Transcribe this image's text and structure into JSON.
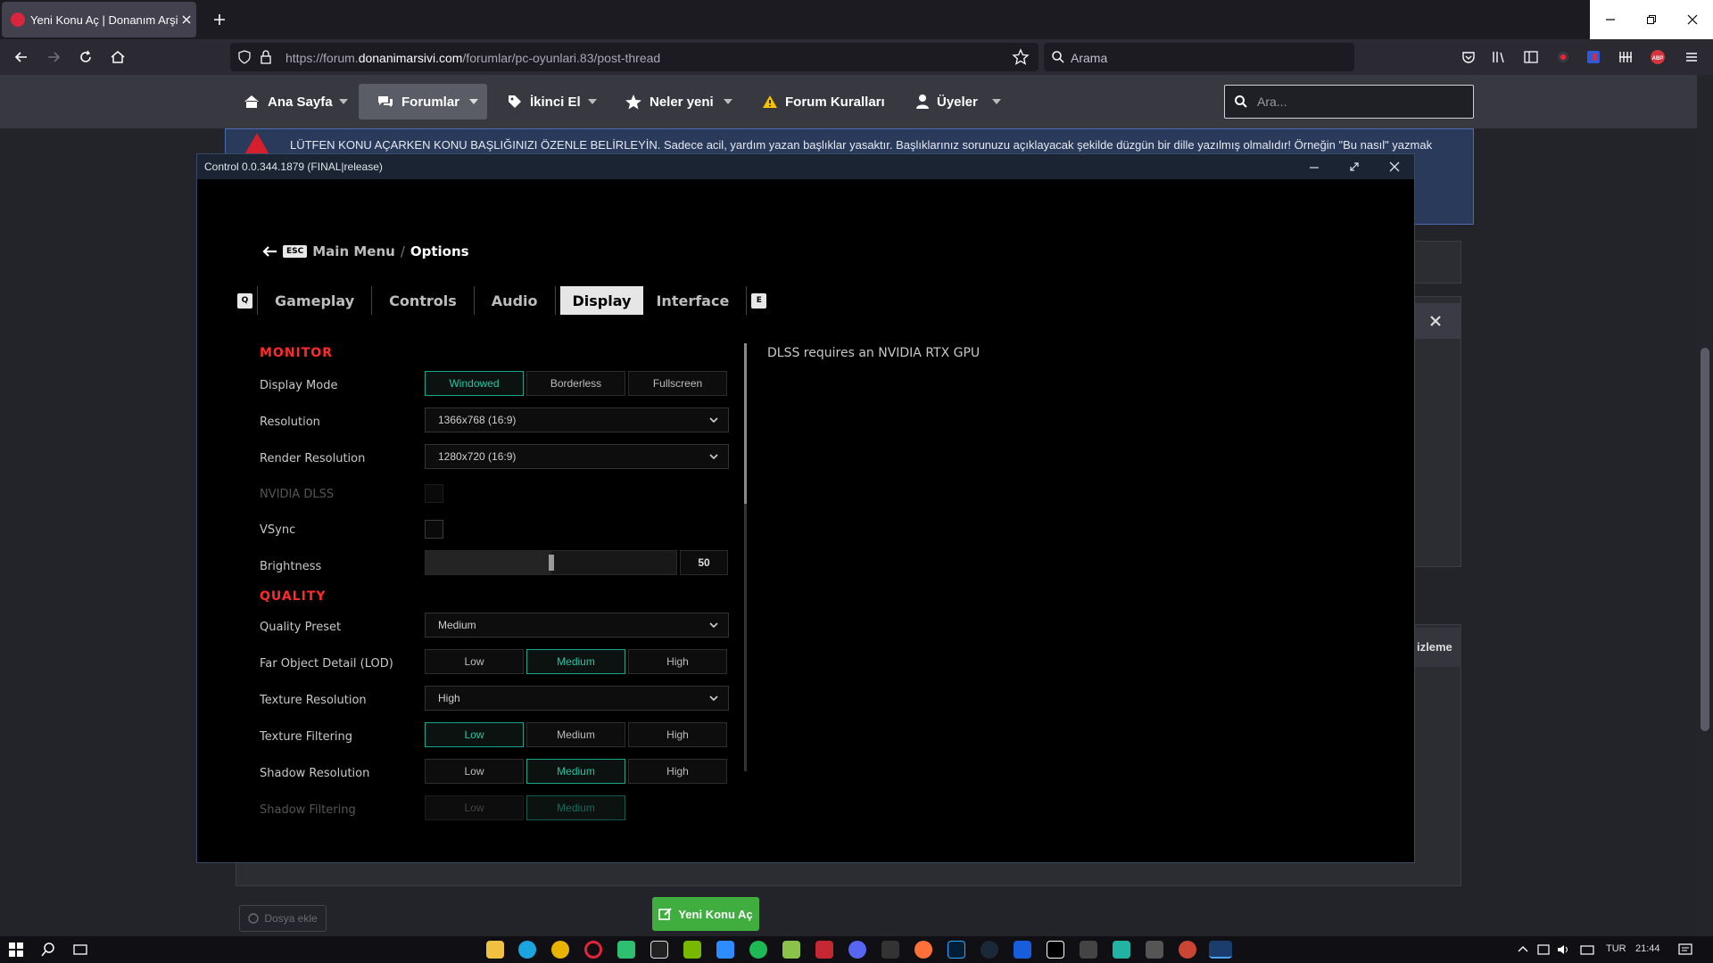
{
  "browser": {
    "tab_title": "Yeni Konu Aç | Donanım Arşivi F",
    "url_prefix": "https://forum.",
    "url_domain": "donanimarsivi.com",
    "url_path": "/forumlar/pc-oyunlari.83/post-thread",
    "search_placeholder": "Arama"
  },
  "site": {
    "nav": {
      "home": "Ana Sayfa",
      "forums": "Forumlar",
      "second_hand": "İkinci El",
      "whats_new": "Neler yeni",
      "rules": "Forum Kuralları",
      "members": "Üyeler"
    },
    "search_placeholder": "Ara...",
    "notice": "LÜTFEN KONU AÇARKEN KONU BAŞLIĞINIZI ÖZENLE BELİRLEYİN. Sadece acil, yardım yazan başlıklar yasaktır. Başlıklarınız sorunuzu açıklayacak şekilde düzgün bir dille yazılmış olmalıdır! Örneğin \"Bu nasıl\" yazmak",
    "preview_label": "izleme",
    "attach_label": "Dosya ekle",
    "new_thread_label": "Yeni Konu Aç"
  },
  "game": {
    "window_title": "Control 0.0.344.1879 (FINAL|release)",
    "breadcrumb": {
      "esc": "ESC",
      "main": "Main Menu",
      "sep": "/",
      "current": "Options"
    },
    "tabs": {
      "left_key": "Q",
      "right_key": "E",
      "items": [
        "Gameplay",
        "Controls",
        "Audio",
        "Display",
        "Interface"
      ],
      "active": "Display"
    },
    "monitor": {
      "title": "MONITOR",
      "display_mode": {
        "label": "Display Mode",
        "options": [
          "Windowed",
          "Borderless",
          "Fullscreen"
        ],
        "selected": "Windowed"
      },
      "resolution": {
        "label": "Resolution",
        "value": "1366x768 (16:9)"
      },
      "render_resolution": {
        "label": "Render Resolution",
        "value": "1280x720 (16:9)"
      },
      "dlss": {
        "label": "NVIDIA DLSS",
        "checked": false,
        "disabled": true
      },
      "vsync": {
        "label": "VSync",
        "checked": false
      },
      "brightness": {
        "label": "Brightness",
        "value": "50",
        "level": 0.5
      }
    },
    "quality": {
      "title": "QUALITY",
      "preset": {
        "label": "Quality Preset",
        "value": "Medium"
      },
      "lod": {
        "label": "Far Object Detail (LOD)",
        "options": [
          "Low",
          "Medium",
          "High"
        ],
        "selected": "Medium"
      },
      "texture_resolution": {
        "label": "Texture Resolution",
        "value": "High"
      },
      "texture_filtering": {
        "label": "Texture Filtering",
        "options": [
          "Low",
          "Medium",
          "High"
        ],
        "selected": "Low"
      },
      "shadow_resolution": {
        "label": "Shadow Resolution",
        "options": [
          "Low",
          "Medium",
          "High"
        ],
        "selected": "Medium"
      },
      "shadow_filtering": {
        "label": "Shadow Filtering",
        "options": [
          "Low",
          "Medium"
        ],
        "selected": "Medium"
      }
    },
    "description": "DLSS requires an NVIDIA RTX GPU"
  },
  "taskbar": {
    "language": "TUR",
    "time": "21:44"
  },
  "colors": {
    "accent_teal": "#1ec8a8",
    "section_red": "#ff2a2a",
    "new_thread_green": "#3fae3f",
    "notice_blue": "#2a3a5a"
  }
}
